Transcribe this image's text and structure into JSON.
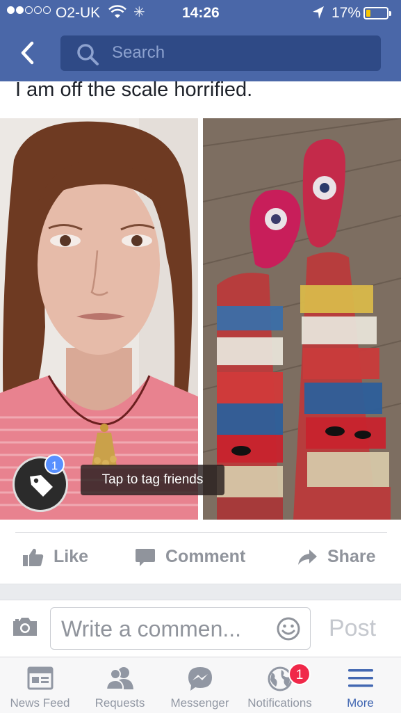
{
  "status_bar": {
    "carrier": "O2-UK",
    "time": "14:26",
    "battery_percent": "17%",
    "battery_level": 0.17,
    "signal_bars_filled": 2,
    "signal_bars_total": 5
  },
  "header": {
    "search_placeholder": "Search",
    "bar_color": "#4a67a8"
  },
  "post": {
    "text": "I am off the scale horrified.",
    "photos": [
      {
        "subject": "woman-selfie"
      },
      {
        "subject": "patterned-trousers-and-leopard-slippers"
      }
    ],
    "tag": {
      "badge_count": "1",
      "tooltip": "Tap to tag friends"
    },
    "actions": {
      "like_label": "Like",
      "comment_label": "Comment",
      "share_label": "Share"
    }
  },
  "comment_composer": {
    "placeholder": "Write a commen...",
    "post_label": "Post"
  },
  "tab_bar": {
    "items": [
      {
        "label": "News Feed",
        "icon": "news-feed-icon"
      },
      {
        "label": "Requests",
        "icon": "friend-requests-icon"
      },
      {
        "label": "Messenger",
        "icon": "messenger-icon"
      },
      {
        "label": "Notifications",
        "icon": "globe-icon",
        "badge": "1"
      },
      {
        "label": "More",
        "icon": "menu-icon",
        "active": true
      }
    ]
  },
  "colors": {
    "accent": "#4267b2",
    "badge_red": "#f02849",
    "tag_badge_blue": "#5890ff"
  }
}
